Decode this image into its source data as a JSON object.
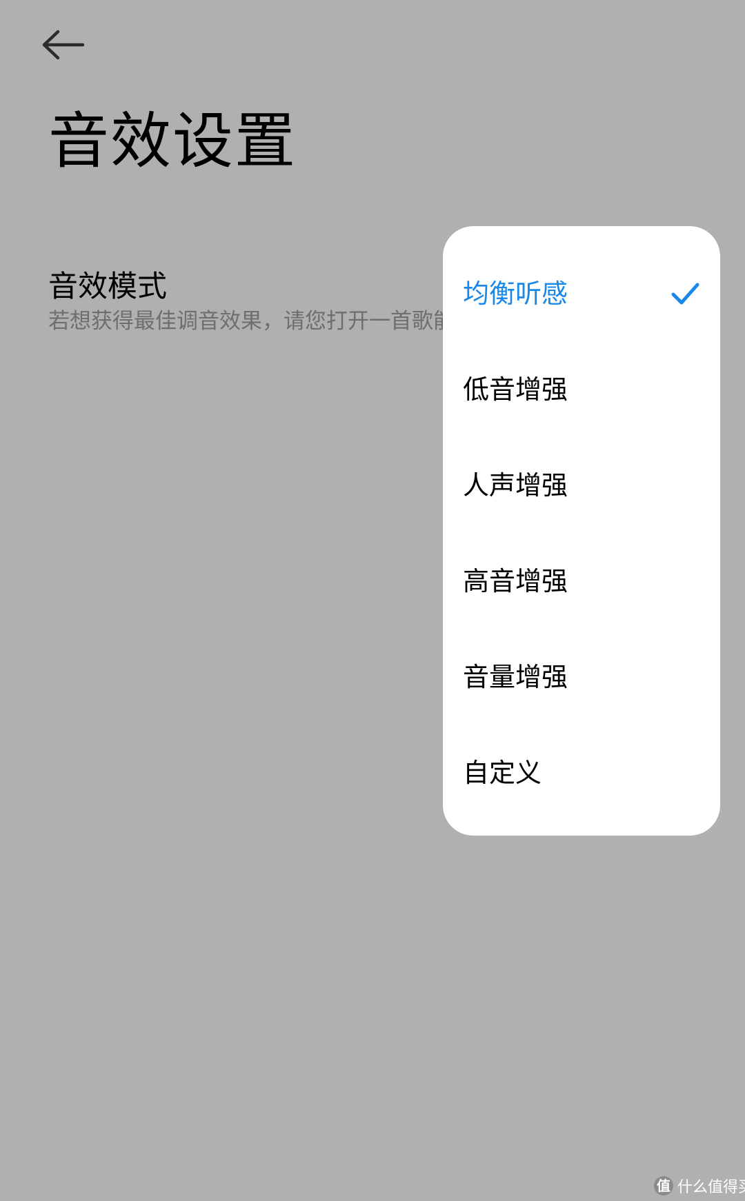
{
  "header": {
    "back_icon": "arrow-left-icon",
    "title": "音效设置"
  },
  "setting": {
    "title": "音效模式",
    "description": "若想获得最佳调音效果，请您打开一首歌能"
  },
  "dropdown": {
    "selected_index": 0,
    "accent_color": "#1a88e8",
    "check_icon": "check-icon",
    "items": [
      {
        "label": "均衡听感",
        "selected": true
      },
      {
        "label": "低音增强",
        "selected": false
      },
      {
        "label": "人声增强",
        "selected": false
      },
      {
        "label": "高音增强",
        "selected": false
      },
      {
        "label": "音量增强",
        "selected": false
      },
      {
        "label": "自定义",
        "selected": false
      }
    ]
  },
  "watermark": {
    "logo": "值",
    "text": "什么值得买"
  },
  "colors": {
    "overlay_background": "#b0b0b0",
    "menu_background": "#ffffff",
    "description_text": "#6e6e6e"
  }
}
